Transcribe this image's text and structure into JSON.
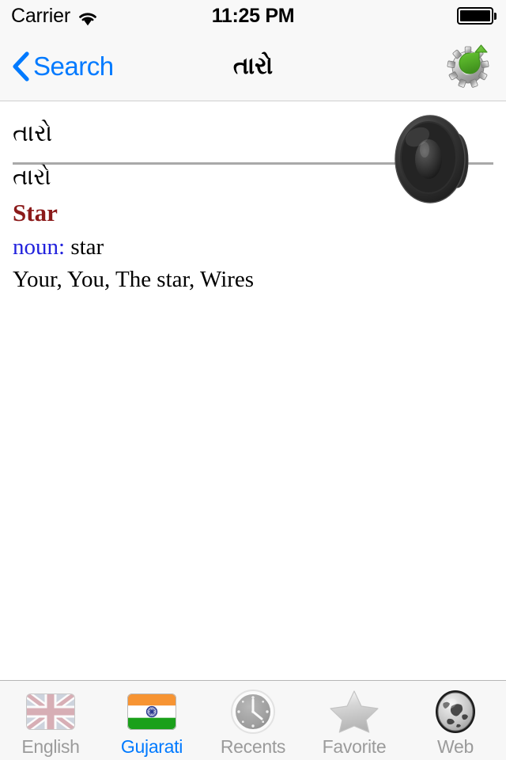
{
  "status_bar": {
    "carrier": "Carrier",
    "wifi_icon": "wifi-icon",
    "time": "11:25 PM",
    "battery_icon": "battery-full-icon"
  },
  "nav_bar": {
    "back_icon": "chevron-left-icon",
    "back_label": "Search",
    "title": "તારો",
    "action_icon": "gear-refresh-icon"
  },
  "content": {
    "headword": "તારો",
    "speaker_icon": "speaker-icon",
    "entry": {
      "word": "તારો",
      "translation": "Star",
      "part_of_speech": "noun",
      "pos_separator": ": ",
      "gloss": "star",
      "senses": "Your, You, The star, Wires"
    }
  },
  "tab_bar": {
    "items": [
      {
        "label": "English",
        "icon": "uk-flag-icon",
        "active": false
      },
      {
        "label": "Gujarati",
        "icon": "india-flag-icon",
        "active": true
      },
      {
        "label": "Recents",
        "icon": "clock-icon",
        "active": false
      },
      {
        "label": "Favorite",
        "icon": "star-icon",
        "active": false
      },
      {
        "label": "Web",
        "icon": "globe-icon",
        "active": false
      }
    ]
  },
  "colors": {
    "accent_blue": "#007aff",
    "translation_red": "#8b1a1a",
    "pos_blue": "#2222dd",
    "chrome_bg": "#f8f8f8",
    "tabbar_bg": "#f7f7f7",
    "inactive_label": "#9b9b9b"
  }
}
